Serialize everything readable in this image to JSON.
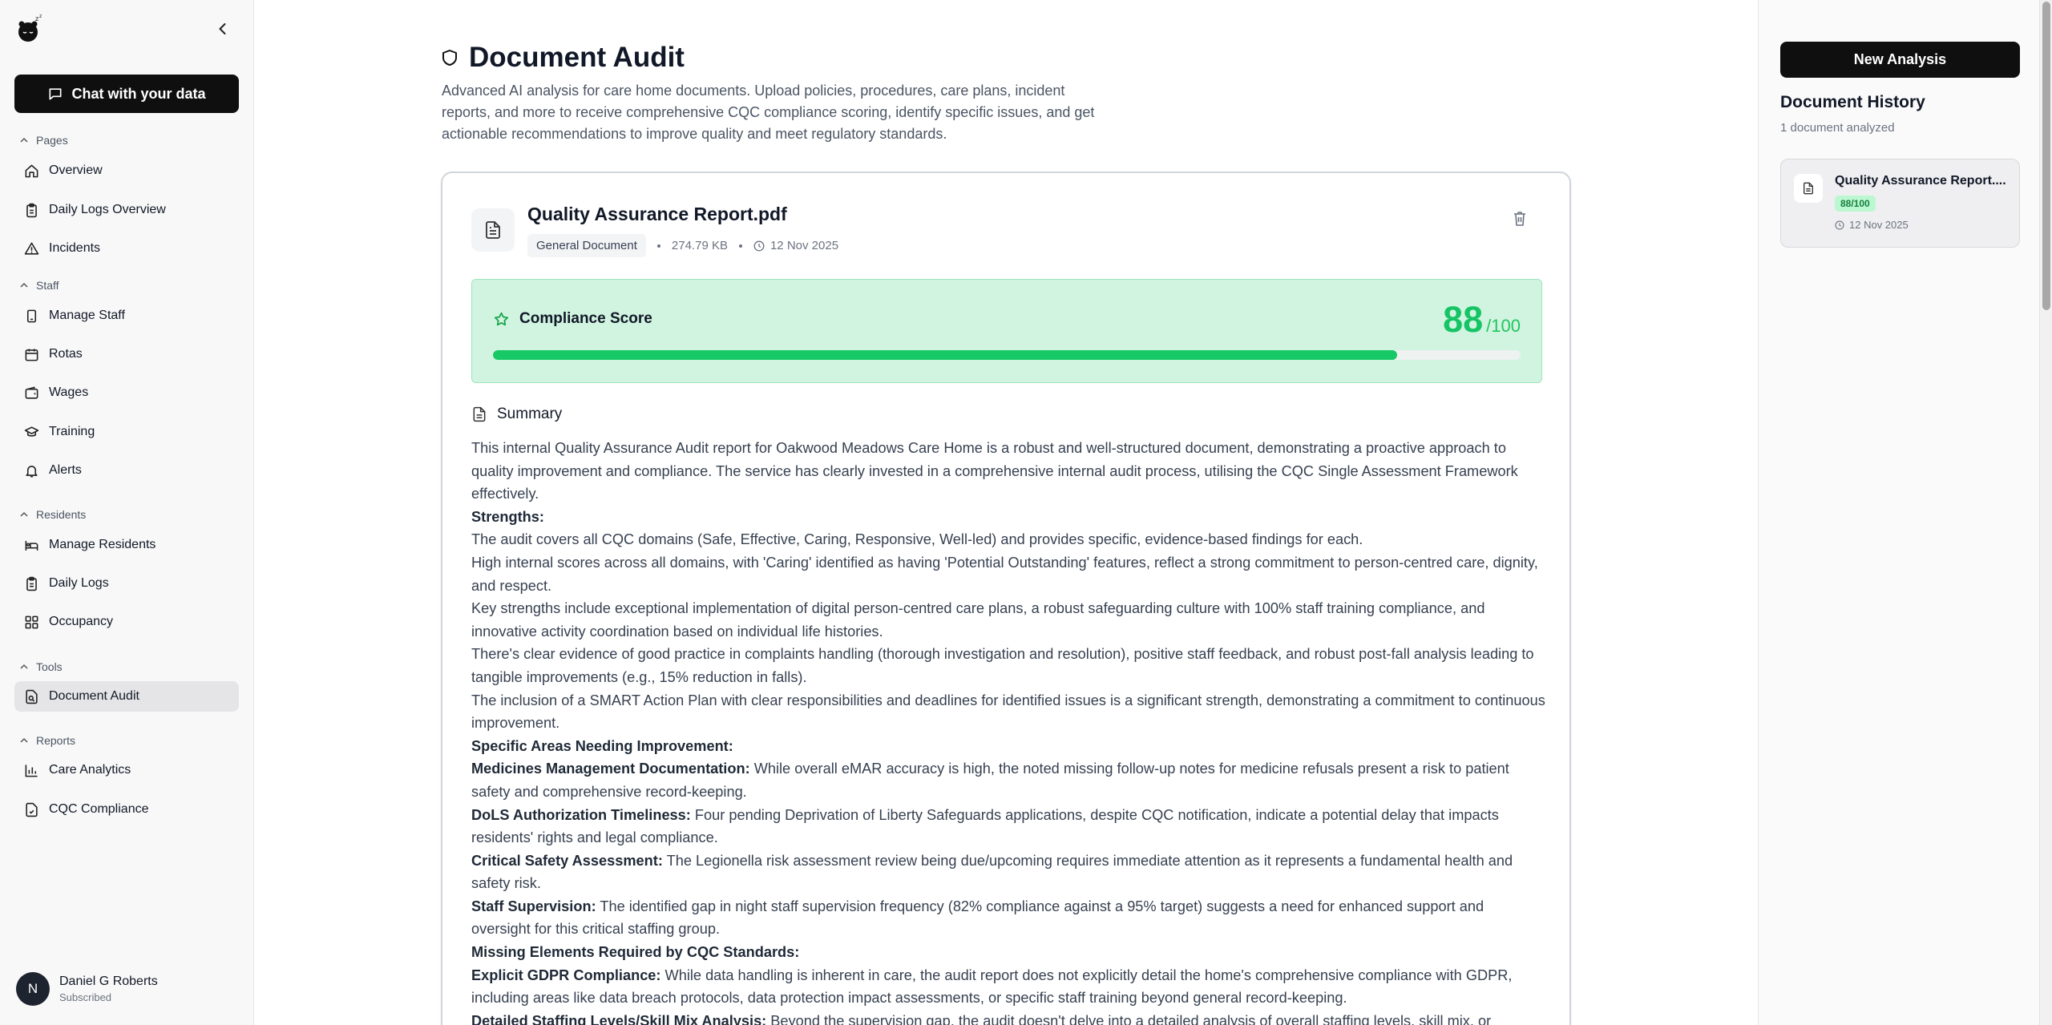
{
  "sidebar": {
    "chat_button": "Chat with your data",
    "sections": {
      "pages": "Pages",
      "staff": "Staff",
      "residents": "Residents",
      "tools": "Tools",
      "reports": "Reports"
    },
    "items": {
      "overview": "Overview",
      "daily_logs_overview": "Daily Logs Overview",
      "incidents": "Incidents",
      "manage_staff": "Manage Staff",
      "rotas": "Rotas",
      "wages": "Wages",
      "training": "Training",
      "alerts": "Alerts",
      "manage_residents": "Manage Residents",
      "daily_logs": "Daily Logs",
      "occupancy": "Occupancy",
      "document_audit": "Document Audit",
      "care_analytics": "Care Analytics",
      "cqc_compliance": "CQC Compliance"
    },
    "active_item": "document_audit",
    "user": {
      "initial": "N",
      "name": "Daniel G Roberts",
      "status": "Subscribed"
    }
  },
  "main": {
    "title": "Document Audit",
    "description": "Advanced AI analysis for care home documents. Upload policies, procedures, care plans, incident reports, and more to receive comprehensive CQC compliance scoring, identify specific issues, and get actionable recommendations to improve quality and meet regulatory standards.",
    "document": {
      "name": "Quality Assurance Report.pdf",
      "type": "General Document",
      "size": "274.79 KB",
      "date": "12 Nov 2025"
    },
    "compliance": {
      "label": "Compliance Score",
      "score": "88",
      "max": "/100",
      "progress_fraction": 0.88
    },
    "summary": {
      "heading": "Summary",
      "lines": [
        {
          "text": "This internal Quality Assurance Audit report for Oakwood Meadows Care Home is a robust and well-structured document, demonstrating a proactive approach to quality improvement and compliance. The service has clearly invested in a comprehensive internal audit process, utilising the CQC Single Assessment Framework effectively."
        },
        {
          "bold": "Strengths:"
        },
        {
          "text": "The audit covers all CQC domains (Safe, Effective, Caring, Responsive, Well-led) and provides specific, evidence-based findings for each."
        },
        {
          "text": "High internal scores across all domains, with 'Caring' identified as having 'Potential Outstanding' features, reflect a strong commitment to person-centred care, dignity, and respect."
        },
        {
          "text": "Key strengths include exceptional implementation of digital person-centred care plans, a robust safeguarding culture with 100% staff training compliance, and innovative activity coordination based on individual life histories."
        },
        {
          "text": "There's clear evidence of good practice in complaints handling (thorough investigation and resolution), positive staff feedback, and robust post-fall analysis leading to tangible improvements (e.g., 15% reduction in falls)."
        },
        {
          "text": "The inclusion of a SMART Action Plan with clear responsibilities and deadlines for identified issues is a significant strength, demonstrating a commitment to continuous improvement."
        },
        {
          "bold": "Specific Areas Needing Improvement:"
        },
        {
          "bold": "Medicines Management Documentation:",
          "text": " While overall eMAR accuracy is high, the noted missing follow-up notes for medicine refusals present a risk to patient safety and comprehensive record-keeping."
        },
        {
          "bold": "DoLS Authorization Timeliness:",
          "text": " Four pending Deprivation of Liberty Safeguards applications, despite CQC notification, indicate a potential delay that impacts residents' rights and legal compliance."
        },
        {
          "bold": "Critical Safety Assessment:",
          "text": " The Legionella risk assessment review being due/upcoming requires immediate attention as it represents a fundamental health and safety risk."
        },
        {
          "bold": "Staff Supervision:",
          "text": " The identified gap in night staff supervision frequency (82% compliance against a 95% target) suggests a need for enhanced support and oversight for this critical staffing group."
        },
        {
          "bold": "Missing Elements Required by CQC Standards:"
        },
        {
          "bold": "Explicit GDPR Compliance:",
          "text": " While data handling is inherent in care, the audit report does not explicitly detail the home's comprehensive compliance with GDPR, including areas like data breach protocols, data protection impact assessments, or specific staff training beyond general record-keeping."
        },
        {
          "bold": "Detailed Staffing Levels/Skill Mix Analysis:",
          "text": " Beyond the supervision gap, the audit doesn't delve into a detailed analysis of overall staffing levels, skill mix, or"
        }
      ]
    }
  },
  "history": {
    "new_button": "New Analysis",
    "title": "Document History",
    "count": "1 document analyzed",
    "items": [
      {
        "name": "Quality Assurance Report....",
        "score": "88/100",
        "date": "12 Nov 2025"
      }
    ]
  },
  "colors": {
    "accent_dark": "#0f0f10",
    "score_green": "#16c466",
    "score_bg": "#d1f4e0",
    "active_nav_bg": "#e5e5e7"
  },
  "icons": {
    "logo": "bear-logo-icon",
    "collapse": "chevron-left-icon",
    "chat": "message-square-icon",
    "section_toggle": "chevron-up-icon",
    "page_title": "shield-icon",
    "document": "file-text-icon",
    "delete": "trash-icon",
    "score": "star-icon",
    "date": "clock-icon"
  }
}
